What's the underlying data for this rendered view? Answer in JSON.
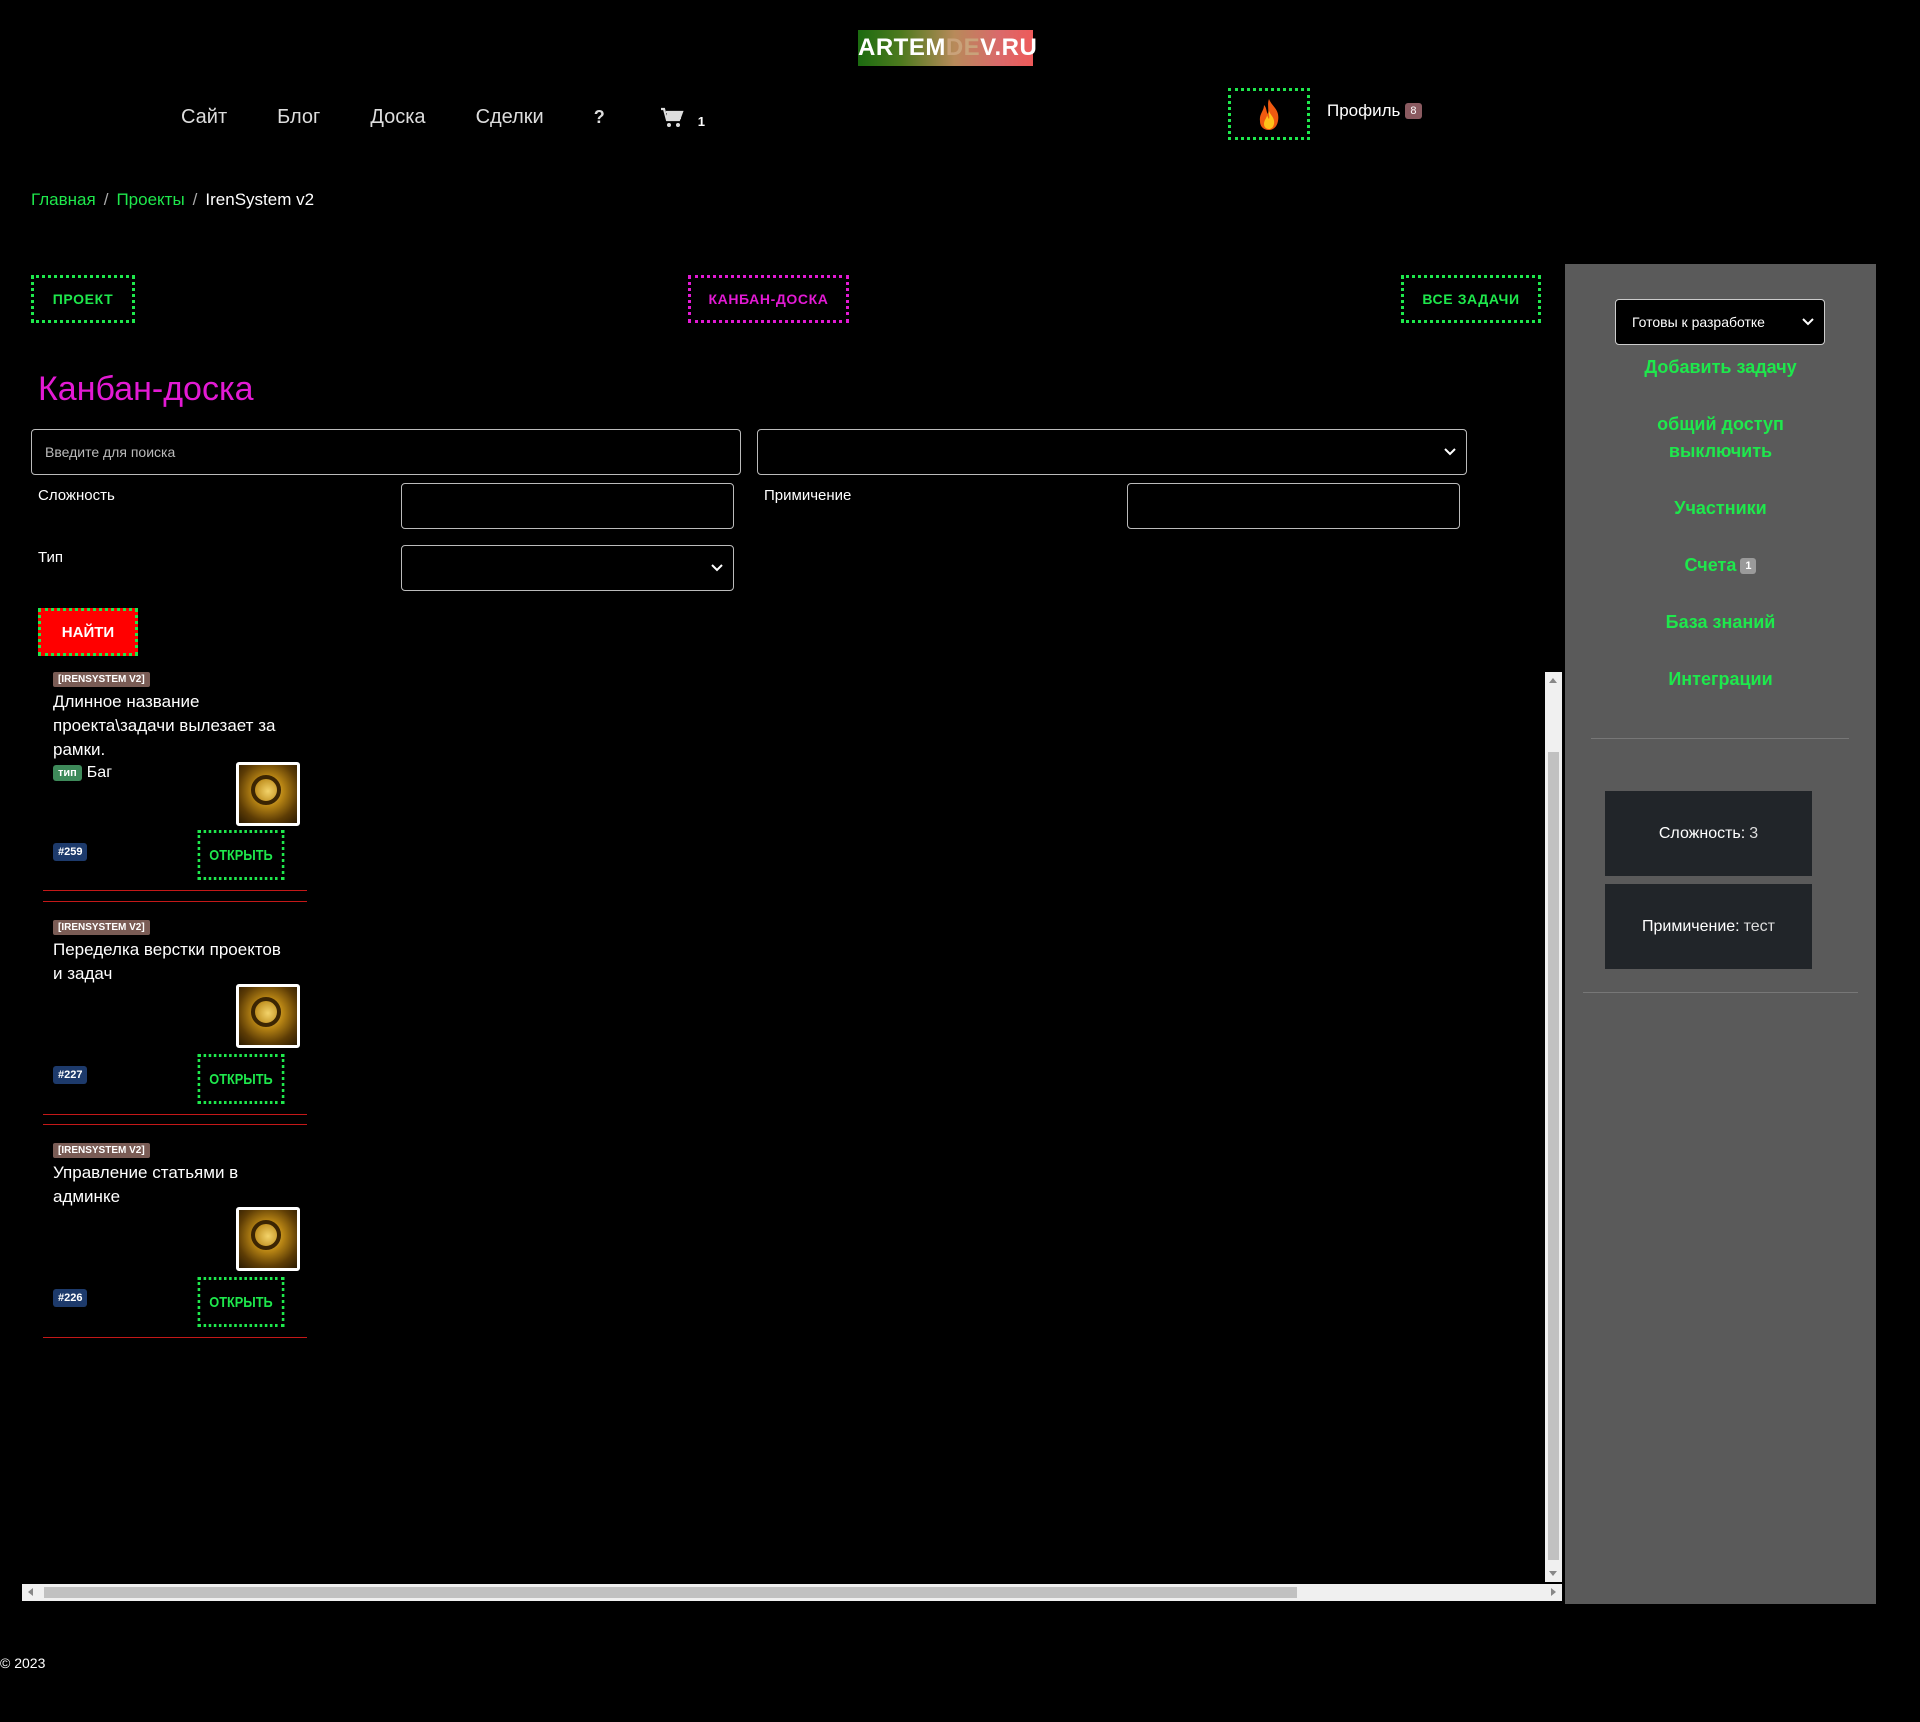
{
  "logo": {
    "part1": "ARTEM",
    "part2": "DE",
    "part3": "V.RU"
  },
  "nav": {
    "items": [
      "Сайт",
      "Блог",
      "Доска",
      "Сделки"
    ],
    "help": "?",
    "cart_count": "1",
    "profile": "Профиль",
    "profile_badge": "8"
  },
  "breadcrumb": {
    "home": "Главная",
    "sep": "/",
    "projects": "Проекты",
    "current": "IrenSystem v2"
  },
  "tabs": {
    "project": "ПРОЕКТ",
    "kanban": "КАНБАН-ДОСКА",
    "all_tasks": "ВСЕ ЗАДАЧИ"
  },
  "page_title": "Канбан-доска",
  "filters": {
    "search_placeholder": "Введите для поиска",
    "complexity_label": "Сложность",
    "note_label": "Примичение",
    "type_label": "Тип",
    "find_button": "НАЙТИ"
  },
  "cards": [
    {
      "tag": "[IRENSYSTEM V2]",
      "title": "Длинное название проекта\\задачи вылезает за рамки.",
      "type_label": "тип",
      "type_value": "Баг",
      "number": "#259",
      "open": "ОТКРЫТЬ"
    },
    {
      "tag": "[IRENSYSTEM V2]",
      "title": "Переделка верстки проектов и задач",
      "number": "#227",
      "open": "ОТКРЫТЬ"
    },
    {
      "tag": "[IRENSYSTEM V2]",
      "title": "Управление статьями в админке",
      "number": "#226",
      "open": "ОТКРЫТЬ"
    }
  ],
  "sidebar": {
    "status_select": "Готовы к разработке",
    "add_task": "Добавить задачу",
    "share_line1": "общий доступ",
    "share_line2": "выключить",
    "members": "Участники",
    "invoices": "Счета",
    "invoices_badge": "1",
    "knowledge": "База знаний",
    "integrations": "Интеграции",
    "complexity_label": "Сложность:",
    "complexity_value": "3",
    "note_label": "Примичение:",
    "note_value": "тест"
  },
  "footer": "© 2023",
  "colors": {
    "accent_green": "#1ee84c",
    "accent_pink": "#e31ad4",
    "danger_red": "#ff0000",
    "sidebar_bg": "#5a5a5a"
  }
}
